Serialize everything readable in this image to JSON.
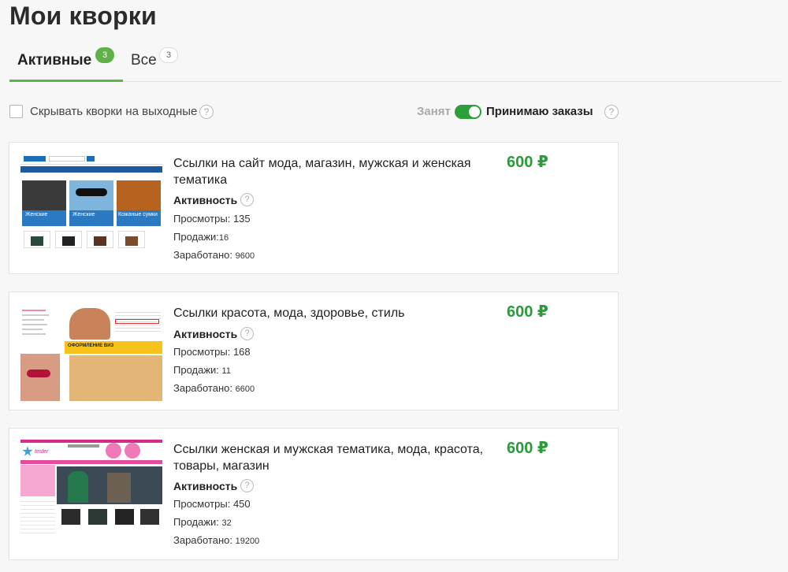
{
  "page": {
    "title": "Мои кворки"
  },
  "tabs": [
    {
      "label": "Активные",
      "count": "3"
    },
    {
      "label": "Все",
      "count": "3"
    }
  ],
  "controls": {
    "hide_weekends_label": "Скрывать кворки на выходные",
    "busy_label": "Занят",
    "accepting_label": "Принимаю заказы",
    "help": "?"
  },
  "gigs": [
    {
      "title": "Ссылки на сайт мода, магазин, мужская и женская тематика",
      "price": "600 ₽",
      "activity_label": "Активность",
      "views_label": "Просмотры:",
      "views": "135",
      "sales_label": "Продажи:",
      "sales": "16",
      "earned_label": "Заработано:",
      "earned": "9600",
      "thumb_text": [
        "Женские",
        "Женские",
        "Кожаные сумки"
      ]
    },
    {
      "title": "Ссылки красота, мода, здоровье, стиль",
      "price": "600 ₽",
      "activity_label": "Активность",
      "views_label": "Просмотры:",
      "views": "168",
      "sales_label": "Продажи:",
      "sales": "11",
      "earned_label": "Заработано:",
      "earned": "6600",
      "thumb_text": [
        "ОФОРМЛЕНИЕ ВИЗ"
      ]
    },
    {
      "title": "Ссылки женская и мужская тематика, мода, красота, товары, магазин",
      "price": "600 ₽",
      "activity_label": "Активность",
      "views_label": "Просмотры:",
      "views": "450",
      "sales_label": "Продажи:",
      "sales": "32",
      "earned_label": "Заработано:",
      "earned": "19200",
      "thumb_text": [
        "tester"
      ]
    }
  ],
  "colors": {
    "accent": "#5fb14a",
    "price": "#2a9a3a",
    "toggle": "#2e9e3a"
  }
}
